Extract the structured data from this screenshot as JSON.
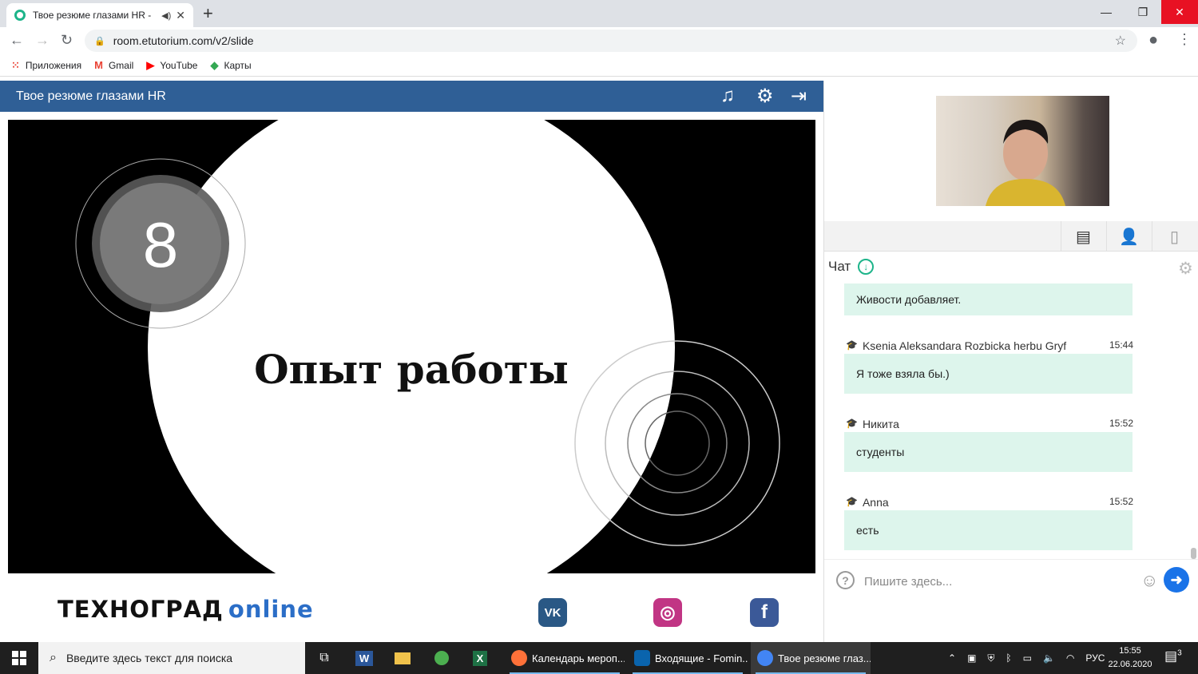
{
  "browser": {
    "tab_title": "Твое резюме глазами HR -",
    "new_tab_glyph": "+",
    "window_controls": {
      "minimize": "—",
      "restore": "❐",
      "close": "✕"
    },
    "url": "room.etutorium.com/v2/slide",
    "bookmarks": [
      {
        "label": "Приложения",
        "icon": "apps-grid-icon"
      },
      {
        "label": "Gmail",
        "icon": "gmail-icon"
      },
      {
        "label": "YouTube",
        "icon": "youtube-icon"
      },
      {
        "label": "Карты",
        "icon": "maps-icon"
      }
    ]
  },
  "app": {
    "title": "Твое резюме глазами HR",
    "toolbar_icons": [
      "music-icon",
      "gear-icon",
      "exit-icon"
    ]
  },
  "slide": {
    "number": "8",
    "heading": "Опыт работы"
  },
  "footer": {
    "logo_main": "ТЕХНОГРАД",
    "logo_suffix": "online",
    "social": [
      {
        "name": "vk",
        "glyph": "VK",
        "color": "#2a5885"
      },
      {
        "name": "instagram",
        "glyph": "◎",
        "color": "#c13584"
      },
      {
        "name": "facebook",
        "glyph": "f",
        "color": "#3b5998"
      }
    ]
  },
  "panel": {
    "tabs": [
      "chat-icon",
      "participants-icon",
      "files-icon"
    ],
    "chat_label": "Чат",
    "messages": [
      {
        "author": "",
        "time": "",
        "text": "Живости добавляет."
      },
      {
        "author": "Ksenia Aleksandara Rozbicka herbu Gryf",
        "time": "15:44",
        "text": "Я тоже взяла бы.)"
      },
      {
        "author": "Никита",
        "time": "15:52",
        "text": "студенты"
      },
      {
        "author": "Anna",
        "time": "15:52",
        "text": "есть"
      }
    ],
    "input_placeholder": "Пишите здесь..."
  },
  "taskbar": {
    "search_placeholder": "Введите здесь текст для поиска",
    "tasks": [
      {
        "label": "Календарь мероп...",
        "color": "#ff7139",
        "active": false
      },
      {
        "label": "Входящие - Fomin...",
        "color": "#0a64ad",
        "active": false
      },
      {
        "label": "Твое резюме глаз...",
        "color": "#4285f4",
        "active": true
      }
    ],
    "lang": "РУС",
    "time": "15:55",
    "date": "22.06.2020",
    "notifications": "3"
  },
  "colors": {
    "app_header": "#2f5f96",
    "chat_bubble": "#ddf5ec",
    "accent": "#1db48a"
  }
}
